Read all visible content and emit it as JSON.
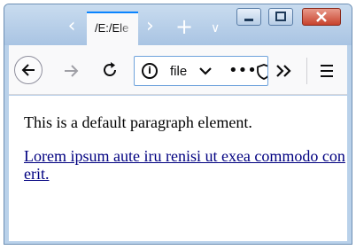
{
  "browser": {
    "tab": {
      "title": "/E:/Ele"
    },
    "toolbar": {
      "url_text": "file",
      "icons": [
        "back-arrow-icon",
        "forward-arrow-icon",
        "reload-icon",
        "info-icon",
        "chevron-down-icon",
        "more-icon",
        "shield-icon",
        "overflow-chevrons-icon",
        "hamburger-menu-icon"
      ]
    },
    "tabstrip_icons": [
      "chevron-left-icon",
      "chevron-right-icon",
      "plus-icon",
      "chevron-down-icon"
    ],
    "window_controls": [
      "minimize-icon",
      "maximize-icon",
      "close-icon"
    ],
    "colors": {
      "accent": "#0a84ff",
      "link": "#000080",
      "titlebar": "#b9d1ea"
    }
  },
  "page": {
    "paragraph": "This is a default paragraph element.",
    "link_text": "Lorem ipsum aute iru renisi ut exea commodo con erit."
  }
}
